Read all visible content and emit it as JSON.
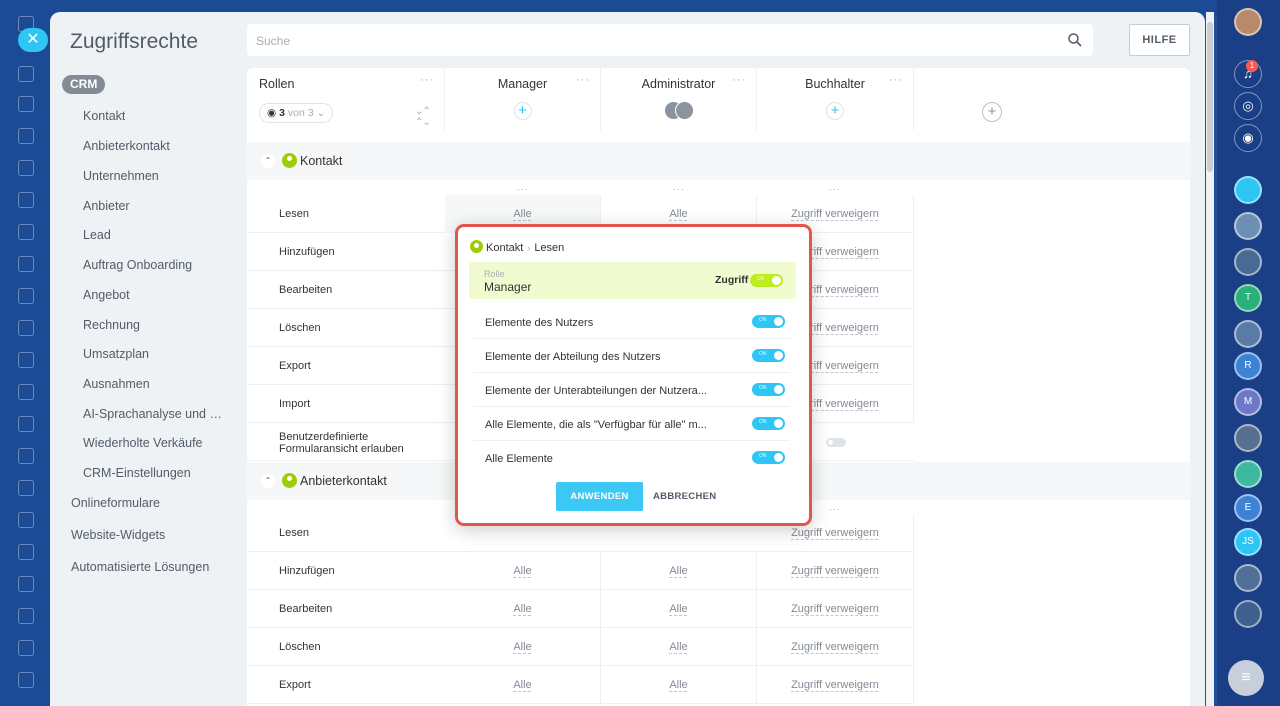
{
  "page": {
    "title": "Zugriffsrechte",
    "search_placeholder": "Suche",
    "help_label": "HILFE"
  },
  "nav": {
    "badge": "CRM",
    "items": [
      "Kontakt",
      "Anbieterkontakt",
      "Unternehmen",
      "Anbieter",
      "Lead",
      "Auftrag Onboarding",
      "Angebot",
      "Rechnung",
      "Umsatzplan",
      "Ausnahmen",
      "AI-Sprachanalyse und Ve...",
      "Wiederholte Verkäufe",
      "CRM-Einstellungen"
    ],
    "top_items": [
      "Onlineformulare",
      "Website-Widgets",
      "Automatisierte Lösungen"
    ]
  },
  "table": {
    "roles_header": "Rollen",
    "role_filter": {
      "count": "3",
      "of": "von 3"
    },
    "columns": [
      "Manager",
      "Administrator",
      "Buchhalter"
    ],
    "dots": "···",
    "sections": [
      {
        "name": "Kontakt",
        "rows": [
          {
            "label": "Lesen",
            "manager": "Alle",
            "admin": "Alle",
            "buchhalter": "Zugriff verweigern"
          },
          {
            "label": "Hinzufügen",
            "manager": "",
            "admin": "",
            "buchhalter": "Zugriff verweigern"
          },
          {
            "label": "Bearbeiten",
            "manager": "",
            "admin": "",
            "buchhalter": "Zugriff verweigern"
          },
          {
            "label": "Löschen",
            "manager": "",
            "admin": "",
            "buchhalter": "Zugriff verweigern"
          },
          {
            "label": "Export",
            "manager": "",
            "admin": "",
            "buchhalter": "Zugriff verweigern"
          },
          {
            "label": "Import",
            "manager": "",
            "admin": "",
            "buchhalter": "Zugriff verweigern"
          },
          {
            "label": "Benutzerdefinierte Formularansicht erlauben",
            "manager": "",
            "admin": "",
            "buchhalter": ""
          }
        ]
      },
      {
        "name": "Anbieterkontakt",
        "rows": [
          {
            "label": "Lesen",
            "manager": "",
            "admin": "",
            "buchhalter": "Zugriff verweigern"
          },
          {
            "label": "Hinzufügen",
            "manager": "Alle",
            "admin": "Alle",
            "buchhalter": "Zugriff verweigern"
          },
          {
            "label": "Bearbeiten",
            "manager": "Alle",
            "admin": "Alle",
            "buchhalter": "Zugriff verweigern"
          },
          {
            "label": "Löschen",
            "manager": "Alle",
            "admin": "Alle",
            "buchhalter": "Zugriff verweigern"
          },
          {
            "label": "Export",
            "manager": "Alle",
            "admin": "Alle",
            "buchhalter": "Zugriff verweigern"
          }
        ]
      }
    ]
  },
  "popup": {
    "crumb_entity": "Kontakt",
    "crumb_sep": "›",
    "crumb_action": "Lesen",
    "role_label": "Rolle",
    "role_name": "Manager",
    "access_label": "Zugriff",
    "toggle_on": "ON",
    "options": [
      "Elemente des Nutzers",
      "Elemente der Abteilung des Nutzers",
      "Elemente der Unterabteilungen der Nutzera...",
      "Alle Elemente, die als \"Verfügbar für alle\" m...",
      "Alle Elemente"
    ],
    "apply_label": "ANWENDEN",
    "cancel_label": "ABBRECHEN"
  },
  "rail": {
    "notification_count": "1",
    "avatars": [
      "T",
      "R",
      "M",
      "E",
      "JS"
    ]
  },
  "colors": {
    "accent": "#2fc6f6",
    "green": "#9dcf00",
    "highlight_border": "#e2574c"
  }
}
